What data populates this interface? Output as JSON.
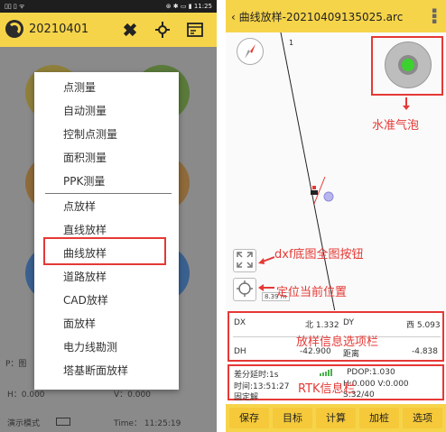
{
  "left": {
    "status": {
      "left": "▯▯ ▯ ᯤ",
      "right": "⊛ ✱ ▭ ▮ 11:25"
    },
    "header": {
      "title": "20210401"
    },
    "menu": {
      "items": [
        "点测量",
        "自动测量",
        "控制点测量",
        "面积测量",
        "PPK测量",
        "点放样",
        "直线放样",
        "曲线放样",
        "道路放样",
        "CAD放样",
        "面放样",
        "电力线勘测",
        "塔基断面放样"
      ],
      "highlighted": "曲线放样"
    },
    "bottom": {
      "p_label": "P：图",
      "h_label": "H：0.000",
      "v_label": "V：0.000",
      "mode_label": "演示模式",
      "time_label": "Time： 11:25:19"
    },
    "colors": {
      "circles": [
        "#f0c93d",
        "#7cc243",
        "#f0a43a",
        "#3a8fd0"
      ]
    }
  },
  "right": {
    "header": {
      "title": "曲线放样-20210409135025.arc",
      "back": "‹"
    },
    "map": {
      "line_label": "1",
      "scale_label": "8.39 m",
      "annotations": {
        "bubble": "水准气泡",
        "dxf": "dxf底图全图按钮",
        "locate": "定位当前位置",
        "stakeout": "放样信息选项栏",
        "rtk": "RTK信息栏"
      }
    },
    "stakeout": {
      "dx_label": "DX",
      "dx_value": "北 1.332",
      "dy_label": "DY",
      "dy_value": "西 5.093",
      "dh_label": "DH",
      "dh_value": "-42.900",
      "dist_label": "距离",
      "dist_value": "-4.838"
    },
    "rtk": {
      "delay": "差分延时:1s",
      "pdop": "PDOP:1.030",
      "time": "时间:13:51:27",
      "hv": "H:0.000  V:0.000",
      "solution": "固定解",
      "sats": "S:32/40"
    },
    "buttons": [
      "保存",
      "目标",
      "计算",
      "加桩",
      "选项"
    ]
  }
}
